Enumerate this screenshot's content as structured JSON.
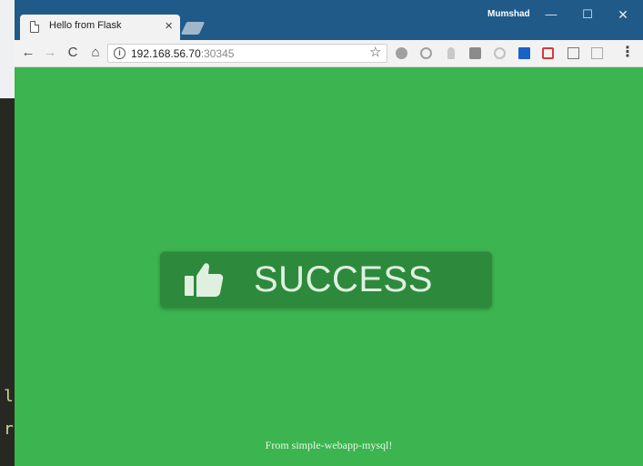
{
  "desktop": {
    "code_lines": [
      "l",
      "r"
    ]
  },
  "window": {
    "user_name": "Mumshad",
    "minimize_glyph": "—",
    "maximize_glyph": "☐",
    "close_glyph": "✕"
  },
  "tabs": [
    {
      "title": "Hello from Flask",
      "close_glyph": "×"
    }
  ],
  "toolbar": {
    "back_glyph": "←",
    "forward_glyph": "→",
    "reload_glyph": "C",
    "home_glyph": "⌂",
    "info_glyph": "i",
    "url_host": "192.168.56.70",
    "url_port": ":30345",
    "star_glyph": "☆",
    "menu_glyph": "⋮",
    "extension_icons": [
      "angular-icon",
      "circle-icon",
      "pen-icon",
      "camera-icon",
      "ring-icon",
      "bookmark-icon",
      "pocket-icon",
      "square-icon",
      "edit-icon"
    ]
  },
  "page": {
    "success_label": "SUCCESS",
    "footer": "From simple-webapp-mysql!",
    "background_color": "#3cb44f",
    "button_color": "#2d8a3c"
  }
}
